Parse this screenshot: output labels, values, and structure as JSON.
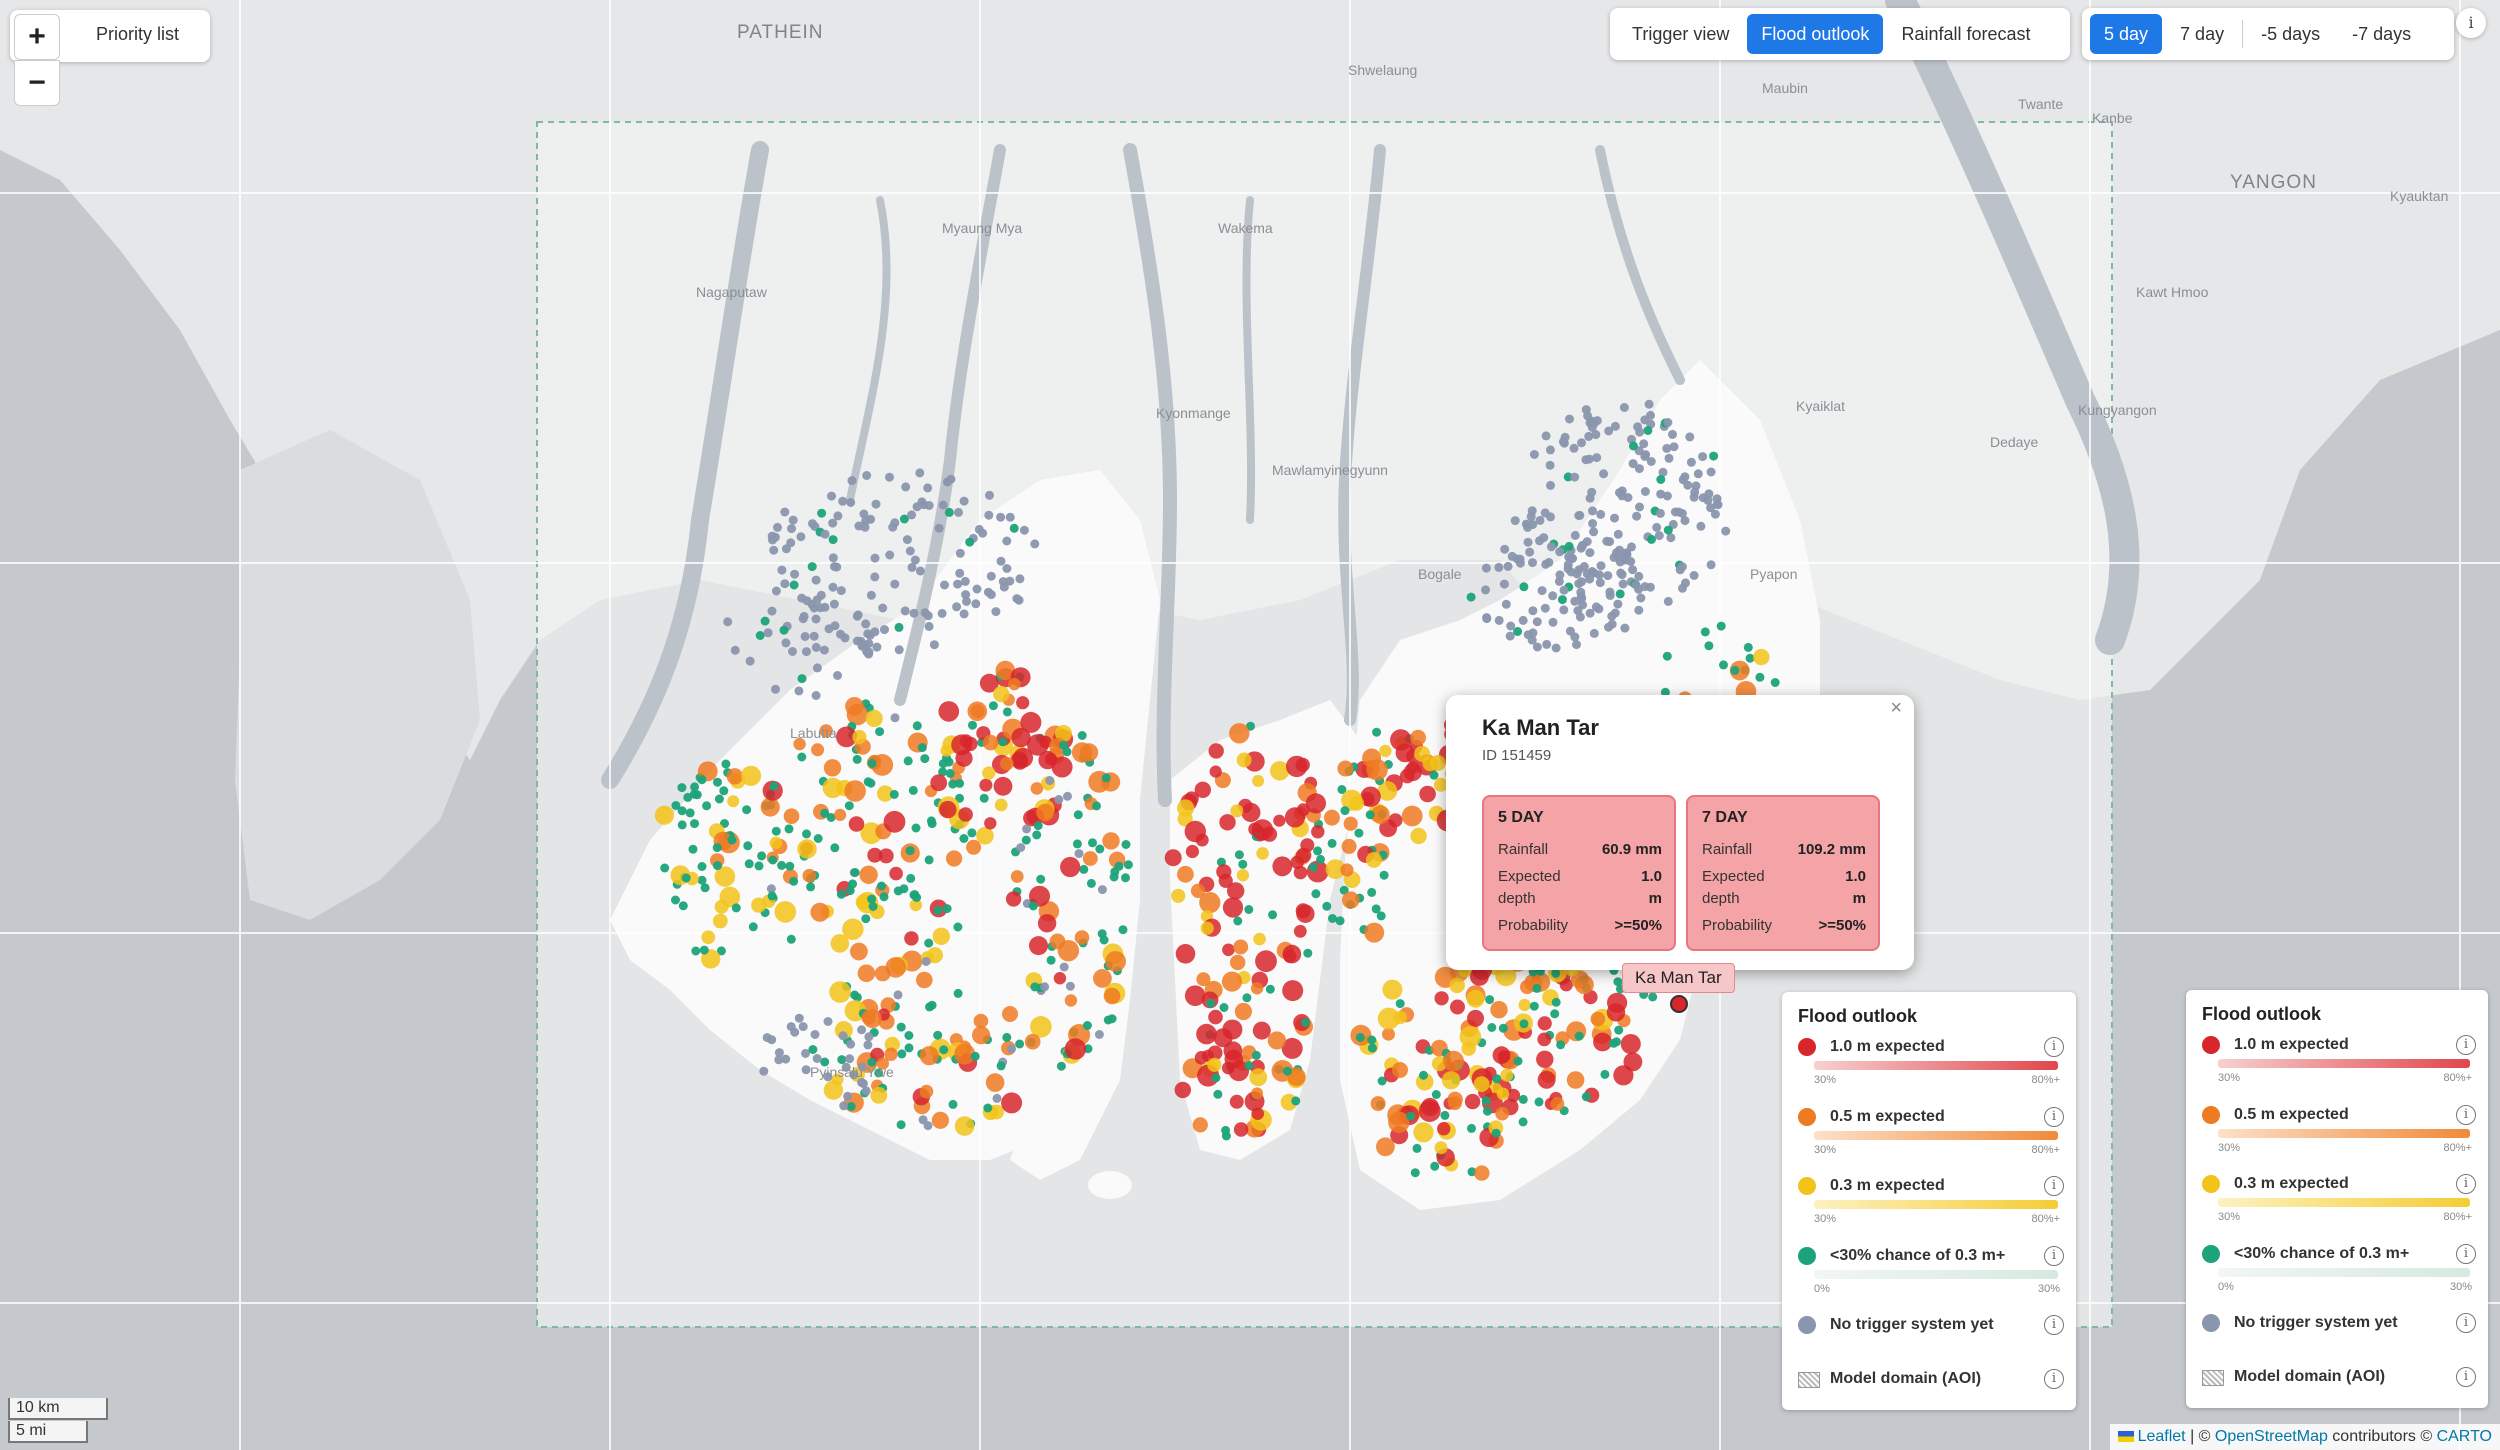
{
  "toolbar": {
    "zoom_in": "+",
    "zoom_out": "−",
    "priority_list": "Priority list"
  },
  "view_tabs": {
    "trigger_view": "Trigger view",
    "flood_outlook": "Flood outlook",
    "rainfall_forecast": "Rainfall forecast",
    "active": "flood_outlook"
  },
  "horizon_tabs": {
    "five_day": "5 day",
    "seven_day": "7 day",
    "minus_five_days": "-5 days",
    "minus_seven_days": "-7 days",
    "active": "five_day"
  },
  "info_button": "i",
  "map_labels": [
    {
      "text": "PATHEIN",
      "big": true
    },
    {
      "text": "Shwelaung",
      "big": false
    },
    {
      "text": "Maubin",
      "big": false
    },
    {
      "text": "Twante",
      "big": false
    },
    {
      "text": "Kanbe",
      "big": false
    },
    {
      "text": "YANGON",
      "big": true
    },
    {
      "text": "Kyauktan",
      "big": false
    },
    {
      "text": "Myaung Mya",
      "big": false
    },
    {
      "text": "Wakema",
      "big": false
    },
    {
      "text": "Nagaputaw",
      "big": false
    },
    {
      "text": "Kawt Hmoo",
      "big": false
    },
    {
      "text": "Kyonmange",
      "big": false
    },
    {
      "text": "Kyaiklat",
      "big": false
    },
    {
      "text": "Kungyangon",
      "big": false
    },
    {
      "text": "Mawlamyinegyunn",
      "big": false
    },
    {
      "text": "Dedaye",
      "big": false
    },
    {
      "text": "Pyapon",
      "big": false
    },
    {
      "text": "Bogale",
      "big": false
    },
    {
      "text": "Labutta",
      "big": false
    },
    {
      "text": "Pyinsalu Ywe",
      "big": false
    }
  ],
  "popup": {
    "close": "×",
    "title": "Ka Man Tar",
    "id": "ID 151459",
    "cards": [
      {
        "title": "5 DAY",
        "rainfall_label": "Rainfall",
        "rainfall": "60.9 mm",
        "depth_label_1": "Expected",
        "depth_label_2": "depth",
        "depth_value": "1.0",
        "depth_unit": "m",
        "prob_label": "Probability",
        "prob": ">=50%"
      },
      {
        "title": "7 DAY",
        "rainfall_label": "Rainfall",
        "rainfall": "109.2 mm",
        "depth_label_1": "Expected",
        "depth_label_2": "depth",
        "depth_value": "1.0",
        "depth_unit": "m",
        "prob_label": "Probability",
        "prob": ">=50%"
      }
    ]
  },
  "marker_label": "Ka Man Tar",
  "legend": {
    "title": "Flood outlook",
    "items": [
      {
        "label": "1.0 m expected",
        "color": "#d7262c",
        "bar_from": "#f7d0d0",
        "bar_to": "#e0474c",
        "min": "30%",
        "max": "80%+"
      },
      {
        "label": "0.5 m expected",
        "color": "#ee7a22",
        "bar_from": "#fde0c8",
        "bar_to": "#f08a3a",
        "min": "30%",
        "max": "80%+"
      },
      {
        "label": "0.3 m expected",
        "color": "#f2c319",
        "bar_from": "#fdf1c2",
        "bar_to": "#f4cd34",
        "min": "30%",
        "max": "80%+"
      },
      {
        "label": "<30% chance of 0.3 m+",
        "color": "#1ca37a",
        "bar_from": "#f2f6f4",
        "bar_to": "#d5eadf",
        "min": "0%",
        "max": "30%"
      },
      {
        "label": "No trigger system yet",
        "color": "#8a96ad"
      },
      {
        "label": "Model domain (AOI)",
        "hatch": true
      }
    ],
    "info": "i"
  },
  "scale": {
    "km": "10 km",
    "mi": "5 mi"
  },
  "attribution": {
    "leaflet": "Leaflet",
    "sep": " | © ",
    "osm": "OpenStreetMap",
    "contrib": " contributors © ",
    "carto": "CARTO"
  },
  "colors": {
    "ocean": "#c5c8cc",
    "land": "#e9eaec",
    "aoi_land": "#f6f6f6",
    "river": "#b9bfc6",
    "active": "#1e78e6"
  }
}
